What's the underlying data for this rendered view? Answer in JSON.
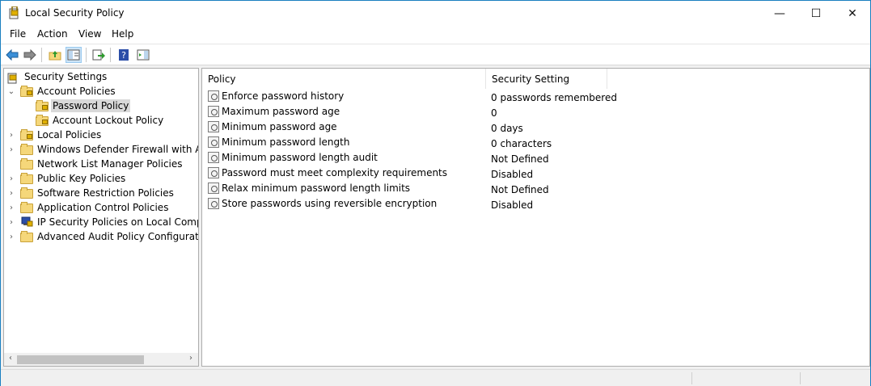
{
  "window": {
    "title": "Local Security Policy"
  },
  "caption": {
    "minimize": "—",
    "maximize": "☐",
    "close": "✕"
  },
  "menu": [
    "File",
    "Action",
    "View",
    "Help"
  ],
  "tree": {
    "root": "Security Settings",
    "items": [
      {
        "label": "Account Policies",
        "expander": "⌄"
      },
      {
        "label": "Password Policy",
        "expander": ""
      },
      {
        "label": "Account Lockout Policy",
        "expander": ""
      },
      {
        "label": "Local Policies",
        "expander": "›"
      },
      {
        "label": "Windows Defender Firewall with Adva",
        "expander": "›"
      },
      {
        "label": "Network List Manager Policies",
        "expander": ""
      },
      {
        "label": "Public Key Policies",
        "expander": "›"
      },
      {
        "label": "Software Restriction Policies",
        "expander": "›"
      },
      {
        "label": "Application Control Policies",
        "expander": "›"
      },
      {
        "label": "IP Security Policies on Local Compute",
        "expander": "›"
      },
      {
        "label": "Advanced Audit Policy Configuration",
        "expander": "›"
      }
    ],
    "scroll_left": "‹",
    "scroll_right": "›"
  },
  "list": {
    "columns": {
      "policy": "Policy",
      "setting": "Security Setting"
    },
    "sort_indicator": "^",
    "rows": [
      {
        "policy": "Enforce password history",
        "setting": "0 passwords remembered"
      },
      {
        "policy": "Maximum password age",
        "setting": "0"
      },
      {
        "policy": "Minimum password age",
        "setting": "0 days"
      },
      {
        "policy": "Minimum password length",
        "setting": "0 characters"
      },
      {
        "policy": "Minimum password length audit",
        "setting": "Not Defined"
      },
      {
        "policy": "Password must meet complexity requirements",
        "setting": "Disabled"
      },
      {
        "policy": "Relax minimum password length limits",
        "setting": "Not Defined"
      },
      {
        "policy": "Store passwords using reversible encryption",
        "setting": "Disabled"
      }
    ]
  },
  "colors": {
    "window_border": "#1a7fc0",
    "folder": "#f5d77a",
    "selection": "#d9d9d9"
  }
}
